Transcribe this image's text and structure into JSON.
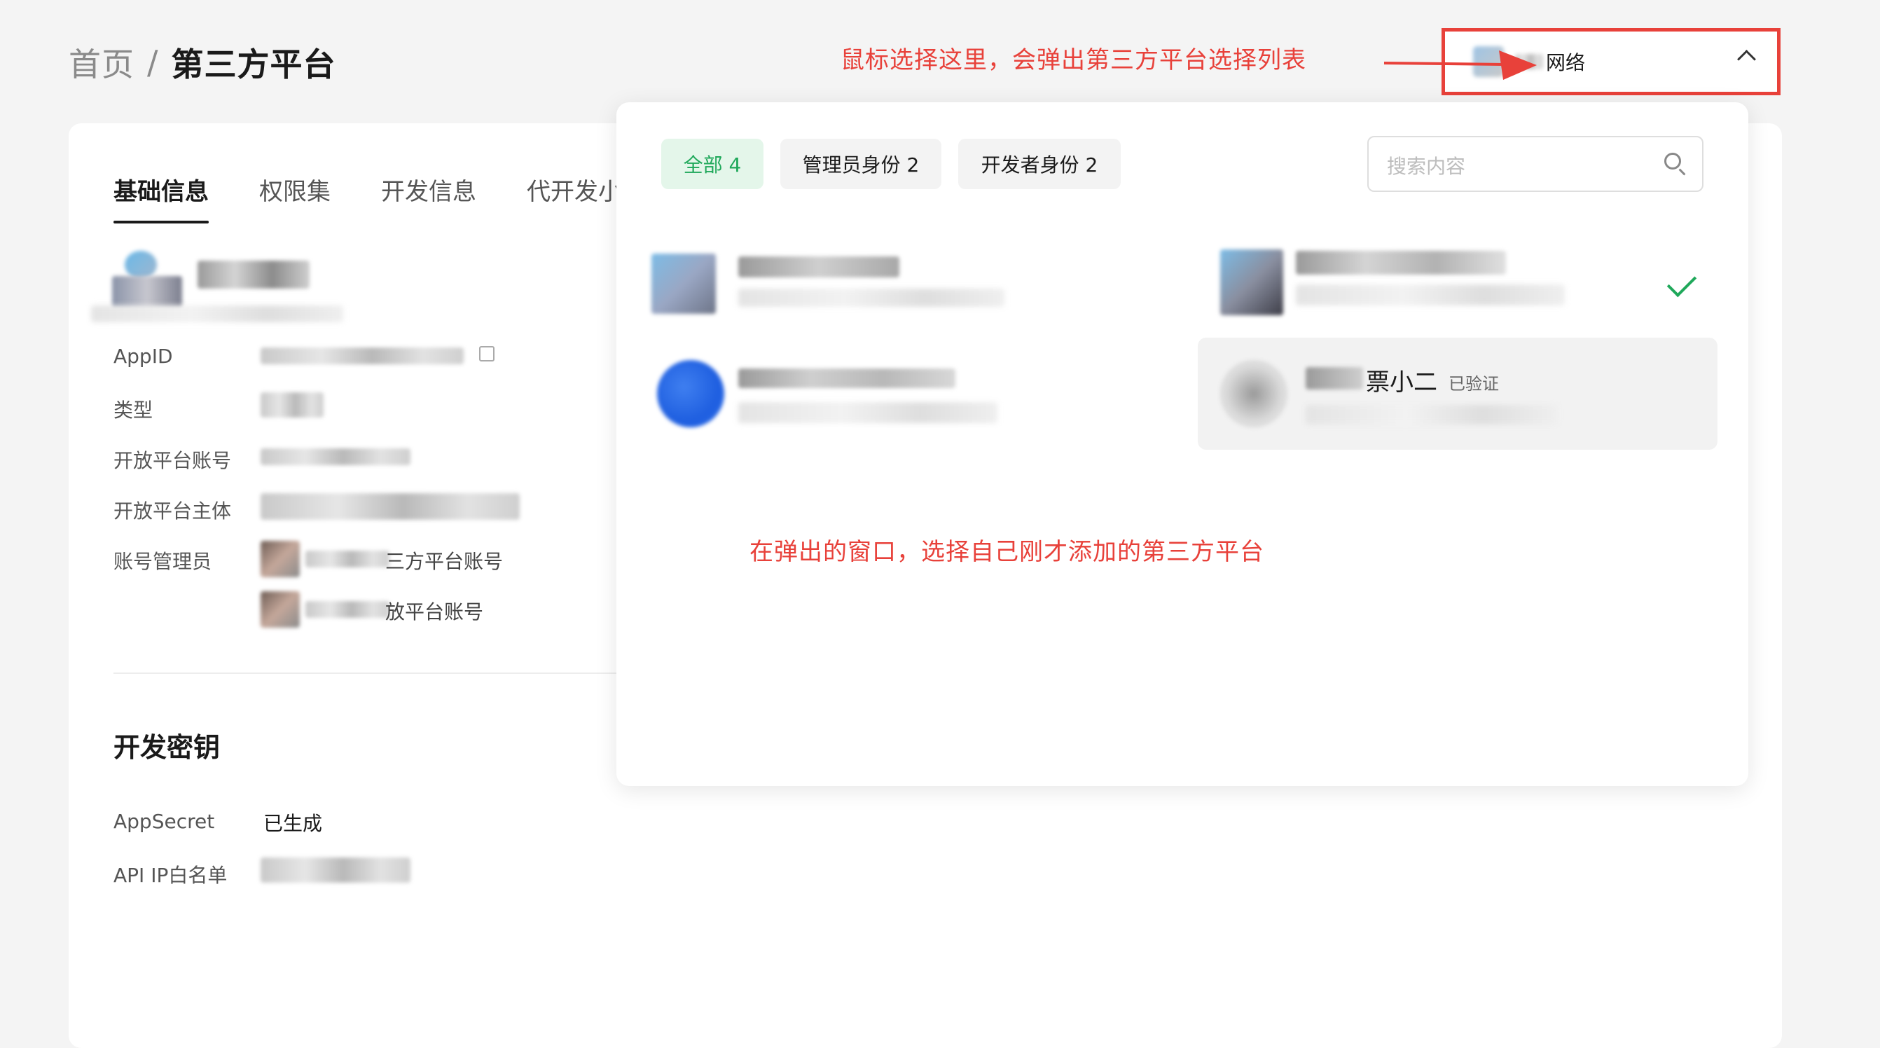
{
  "breadcrumb": {
    "home": "首页",
    "separator": "/",
    "current": "第三方平台"
  },
  "tabs": [
    {
      "label": "基础信息",
      "active": true
    },
    {
      "label": "权限集",
      "active": false
    },
    {
      "label": "开发信息",
      "active": false
    },
    {
      "label": "代开发小",
      "active": false
    }
  ],
  "basic_info": {
    "rows": [
      {
        "label": "AppID"
      },
      {
        "label": "类型"
      },
      {
        "label": "开放平台账号"
      },
      {
        "label": "开放平台主体"
      },
      {
        "label": "账号管理员"
      }
    ],
    "admin_suffix_1": "三方平台账号",
    "admin_suffix_2": "放平台账号"
  },
  "dev_key": {
    "title": "开发密钥",
    "appsecret_label": "AppSecret",
    "appsecret_value": "已生成",
    "ip_whitelist_label": "API IP白名单"
  },
  "selector": {
    "label": "网络",
    "border_color": "#e8413a"
  },
  "annotations": {
    "top": "鼠标选择这里，会弹出第三方平台选择列表",
    "middle": "在弹出的窗口，选择自己刚才添加的第三方平台"
  },
  "dropdown": {
    "filters": [
      {
        "label": "全部 4",
        "active": true
      },
      {
        "label": "管理员身份 2",
        "active": false
      },
      {
        "label": "开发者身份 2",
        "active": false
      }
    ],
    "search_placeholder": "搜索内容",
    "accounts": [
      {
        "name": "",
        "selected": false
      },
      {
        "name": "",
        "badge": "",
        "selected": true
      },
      {
        "name": "",
        "selected": false
      },
      {
        "name": "票小二",
        "badge": "已验证",
        "selected": false
      }
    ]
  },
  "colors": {
    "accent_green": "#1fa85a",
    "annotation_red": "#e8413a"
  }
}
